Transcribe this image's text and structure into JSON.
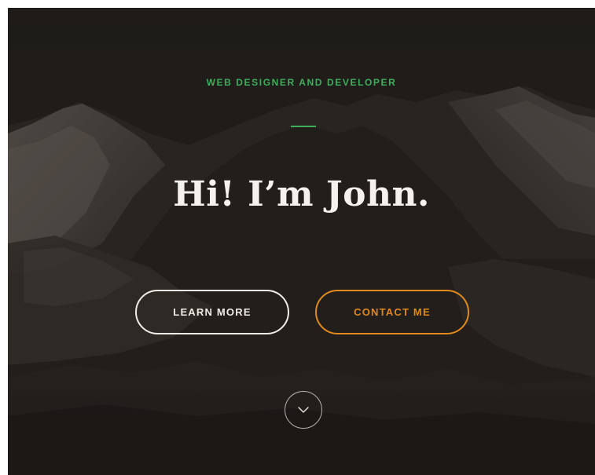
{
  "hero": {
    "tagline": "WEB DESIGNER AND DEVELOPER",
    "headline": "Hi! I’m John.",
    "learn_more_label": "LEARN MORE",
    "contact_label": "CONTACT ME",
    "scroll_icon": "chevron-down-icon"
  },
  "colors": {
    "background": "#272321",
    "accent_green": "#3fae5c",
    "accent_orange": "#e0891d",
    "text_light": "#f5f2ee"
  }
}
